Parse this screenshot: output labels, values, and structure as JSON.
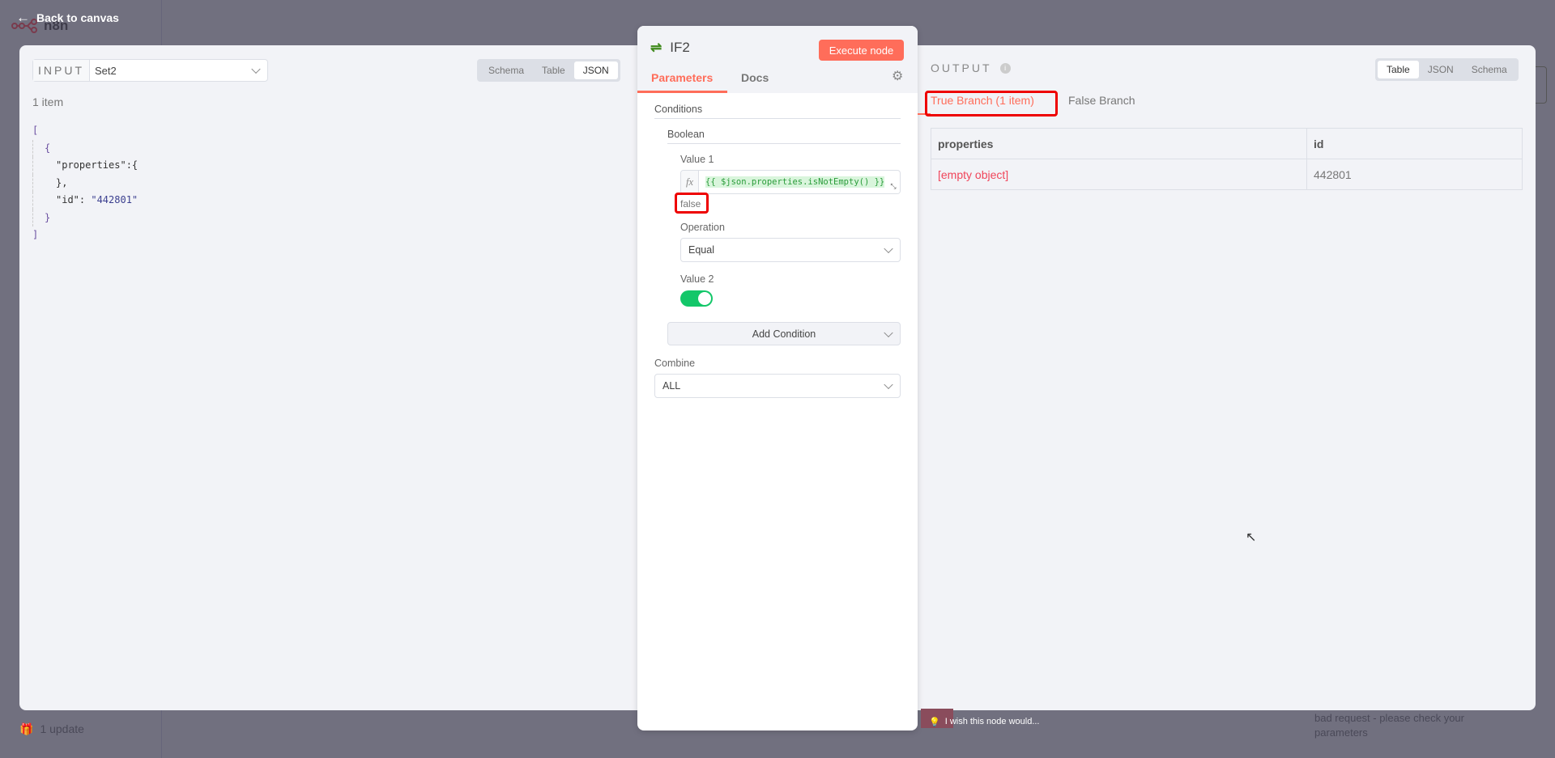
{
  "header": {
    "back_label": "Back to canvas",
    "logo": "n8n"
  },
  "input": {
    "label": "INPUT",
    "node": "Set2",
    "views": [
      "Schema",
      "Table",
      "JSON"
    ],
    "active_view": "JSON",
    "count": "1 item",
    "json_lines": [
      "[",
      "{",
      "\"properties\":{",
      "},",
      "\"id\":",
      "\"442801\"",
      "}",
      "]"
    ]
  },
  "node": {
    "title": "IF2",
    "execute_label": "Execute node",
    "tabs": [
      "Parameters",
      "Docs"
    ],
    "conditions_label": "Conditions",
    "boolean_label": "Boolean",
    "value1_label": "Value 1",
    "fx": "fx",
    "value1_expression": "{{ $json.properties.isNotEmpty() }}",
    "value1_result": "false",
    "operation_label": "Operation",
    "operation_value": "Equal",
    "value2_label": "Value 2",
    "value2_on": true,
    "add_condition_label": "Add Condition",
    "combine_label": "Combine",
    "combine_value": "ALL"
  },
  "output": {
    "label": "OUTPUT",
    "views": [
      "Table",
      "JSON",
      "Schema"
    ],
    "active_view": "Table",
    "branches": [
      "True Branch (1 item)",
      "False Branch"
    ],
    "columns": [
      "properties",
      "id"
    ],
    "rows": [
      [
        "[empty object]",
        "442801"
      ]
    ]
  },
  "footer": {
    "updates": "1 update",
    "feedback": "I wish this node would...",
    "bg_text_1": "bad request - please check your",
    "bg_text_2": "parameters"
  },
  "colors": {
    "accent": "#ff6d5a",
    "toggle": "#13c769",
    "highlight": "#e00000"
  }
}
